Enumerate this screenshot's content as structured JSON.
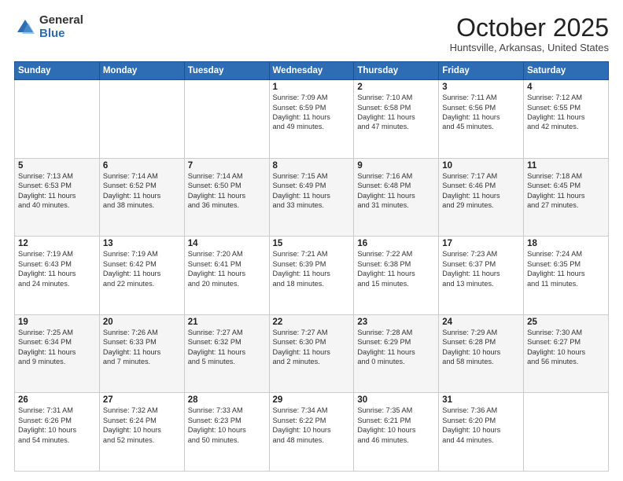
{
  "logo": {
    "general": "General",
    "blue": "Blue"
  },
  "header": {
    "month": "October 2025",
    "location": "Huntsville, Arkansas, United States"
  },
  "weekdays": [
    "Sunday",
    "Monday",
    "Tuesday",
    "Wednesday",
    "Thursday",
    "Friday",
    "Saturday"
  ],
  "weeks": [
    [
      {
        "day": "",
        "info": ""
      },
      {
        "day": "",
        "info": ""
      },
      {
        "day": "",
        "info": ""
      },
      {
        "day": "1",
        "info": "Sunrise: 7:09 AM\nSunset: 6:59 PM\nDaylight: 11 hours\nand 49 minutes."
      },
      {
        "day": "2",
        "info": "Sunrise: 7:10 AM\nSunset: 6:58 PM\nDaylight: 11 hours\nand 47 minutes."
      },
      {
        "day": "3",
        "info": "Sunrise: 7:11 AM\nSunset: 6:56 PM\nDaylight: 11 hours\nand 45 minutes."
      },
      {
        "day": "4",
        "info": "Sunrise: 7:12 AM\nSunset: 6:55 PM\nDaylight: 11 hours\nand 42 minutes."
      }
    ],
    [
      {
        "day": "5",
        "info": "Sunrise: 7:13 AM\nSunset: 6:53 PM\nDaylight: 11 hours\nand 40 minutes."
      },
      {
        "day": "6",
        "info": "Sunrise: 7:14 AM\nSunset: 6:52 PM\nDaylight: 11 hours\nand 38 minutes."
      },
      {
        "day": "7",
        "info": "Sunrise: 7:14 AM\nSunset: 6:50 PM\nDaylight: 11 hours\nand 36 minutes."
      },
      {
        "day": "8",
        "info": "Sunrise: 7:15 AM\nSunset: 6:49 PM\nDaylight: 11 hours\nand 33 minutes."
      },
      {
        "day": "9",
        "info": "Sunrise: 7:16 AM\nSunset: 6:48 PM\nDaylight: 11 hours\nand 31 minutes."
      },
      {
        "day": "10",
        "info": "Sunrise: 7:17 AM\nSunset: 6:46 PM\nDaylight: 11 hours\nand 29 minutes."
      },
      {
        "day": "11",
        "info": "Sunrise: 7:18 AM\nSunset: 6:45 PM\nDaylight: 11 hours\nand 27 minutes."
      }
    ],
    [
      {
        "day": "12",
        "info": "Sunrise: 7:19 AM\nSunset: 6:43 PM\nDaylight: 11 hours\nand 24 minutes."
      },
      {
        "day": "13",
        "info": "Sunrise: 7:19 AM\nSunset: 6:42 PM\nDaylight: 11 hours\nand 22 minutes."
      },
      {
        "day": "14",
        "info": "Sunrise: 7:20 AM\nSunset: 6:41 PM\nDaylight: 11 hours\nand 20 minutes."
      },
      {
        "day": "15",
        "info": "Sunrise: 7:21 AM\nSunset: 6:39 PM\nDaylight: 11 hours\nand 18 minutes."
      },
      {
        "day": "16",
        "info": "Sunrise: 7:22 AM\nSunset: 6:38 PM\nDaylight: 11 hours\nand 15 minutes."
      },
      {
        "day": "17",
        "info": "Sunrise: 7:23 AM\nSunset: 6:37 PM\nDaylight: 11 hours\nand 13 minutes."
      },
      {
        "day": "18",
        "info": "Sunrise: 7:24 AM\nSunset: 6:35 PM\nDaylight: 11 hours\nand 11 minutes."
      }
    ],
    [
      {
        "day": "19",
        "info": "Sunrise: 7:25 AM\nSunset: 6:34 PM\nDaylight: 11 hours\nand 9 minutes."
      },
      {
        "day": "20",
        "info": "Sunrise: 7:26 AM\nSunset: 6:33 PM\nDaylight: 11 hours\nand 7 minutes."
      },
      {
        "day": "21",
        "info": "Sunrise: 7:27 AM\nSunset: 6:32 PM\nDaylight: 11 hours\nand 5 minutes."
      },
      {
        "day": "22",
        "info": "Sunrise: 7:27 AM\nSunset: 6:30 PM\nDaylight: 11 hours\nand 2 minutes."
      },
      {
        "day": "23",
        "info": "Sunrise: 7:28 AM\nSunset: 6:29 PM\nDaylight: 11 hours\nand 0 minutes."
      },
      {
        "day": "24",
        "info": "Sunrise: 7:29 AM\nSunset: 6:28 PM\nDaylight: 10 hours\nand 58 minutes."
      },
      {
        "day": "25",
        "info": "Sunrise: 7:30 AM\nSunset: 6:27 PM\nDaylight: 10 hours\nand 56 minutes."
      }
    ],
    [
      {
        "day": "26",
        "info": "Sunrise: 7:31 AM\nSunset: 6:26 PM\nDaylight: 10 hours\nand 54 minutes."
      },
      {
        "day": "27",
        "info": "Sunrise: 7:32 AM\nSunset: 6:24 PM\nDaylight: 10 hours\nand 52 minutes."
      },
      {
        "day": "28",
        "info": "Sunrise: 7:33 AM\nSunset: 6:23 PM\nDaylight: 10 hours\nand 50 minutes."
      },
      {
        "day": "29",
        "info": "Sunrise: 7:34 AM\nSunset: 6:22 PM\nDaylight: 10 hours\nand 48 minutes."
      },
      {
        "day": "30",
        "info": "Sunrise: 7:35 AM\nSunset: 6:21 PM\nDaylight: 10 hours\nand 46 minutes."
      },
      {
        "day": "31",
        "info": "Sunrise: 7:36 AM\nSunset: 6:20 PM\nDaylight: 10 hours\nand 44 minutes."
      },
      {
        "day": "",
        "info": ""
      }
    ]
  ]
}
